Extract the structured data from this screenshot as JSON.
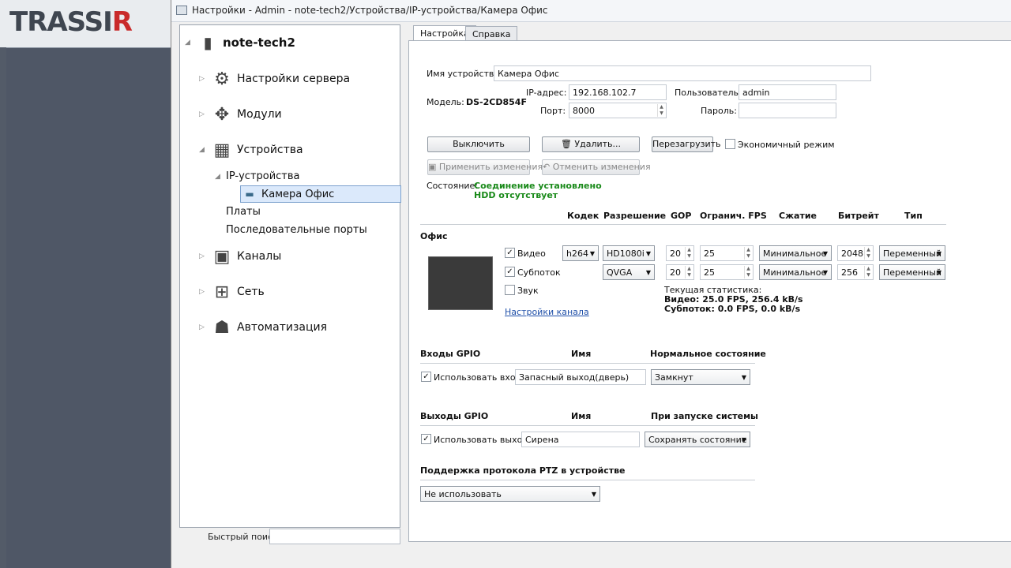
{
  "logo": {
    "text_main": "TRASSI",
    "text_accent": "R"
  },
  "window": {
    "title": "Настройки - Admin - note-tech2/Устройства/IP-устройства/Камера Офис"
  },
  "tree": {
    "root": "note-tech2",
    "items": [
      {
        "label": "Настройки сервера",
        "icon": "gear-icon"
      },
      {
        "label": "Модули",
        "icon": "puzzle-icon"
      },
      {
        "label": "Устройства",
        "icon": "chip-icon"
      },
      {
        "label": "IP-устройства"
      },
      {
        "label": "Камера Офис",
        "icon": "camera-icon"
      },
      {
        "label": "Платы"
      },
      {
        "label": "Последовательные порты"
      },
      {
        "label": "Каналы",
        "icon": "channels-icon"
      },
      {
        "label": "Сеть",
        "icon": "network-icon"
      },
      {
        "label": "Автоматизация",
        "icon": "robot-icon"
      }
    ],
    "quick_search_label": "Быстрый поиск:",
    "quick_search_value": ""
  },
  "tabs": [
    "Настройка",
    "Справка"
  ],
  "device": {
    "name_label": "Имя устройства:",
    "name_value": "Камера Офис",
    "model_label": "Модель:",
    "model_value": "DS-2CD854F",
    "ip_label": "IP-адрес:",
    "ip_value": "192.168.102.7",
    "port_label": "Порт:",
    "port_value": "8000",
    "user_label": "Пользователь:",
    "user_value": "admin",
    "password_label": "Пароль:",
    "password_value": ""
  },
  "buttons": {
    "disable": "Выключить",
    "delete": "Удалить...",
    "reboot": "Перезагрузить",
    "eco_mode": "Экономичный режим",
    "apply": "Применить изменения",
    "cancel": "Отменить изменения"
  },
  "status": {
    "label": "Состояние:",
    "line1": "Соединение установлено",
    "line2": "HDD отсутствует"
  },
  "streams": {
    "headers": {
      "codec": "Кодек",
      "resolution": "Разрешение",
      "gop": "GOP",
      "fps": "Огранич. FPS",
      "compression": "Сжатие",
      "bitrate": "Битрейт",
      "type": "Тип"
    },
    "group": "Офис",
    "video": {
      "label": "Видео",
      "checked": true,
      "codec": "h264",
      "resolution": "HD1080i",
      "gop": "20",
      "fps": "25",
      "compression": "Минимальное",
      "bitrate": "2048",
      "type": "Переменный"
    },
    "substream": {
      "label": "Субпоток",
      "checked": true,
      "resolution": "QVGA",
      "gop": "20",
      "fps": "25",
      "compression": "Минимальное",
      "bitrate": "256",
      "type": "Переменный"
    },
    "audio": {
      "label": "Звук",
      "checked": false
    },
    "channel_settings_link": "Настройки канала",
    "stats_title": "Текущая статистика:",
    "stats_video": "Видео: 25.0 FPS, 256.4 kB/s",
    "stats_sub": "Субпоток: 0.0 FPS, 0.0 kB/s"
  },
  "gpio_in": {
    "title": "Входы GPIO",
    "name_header": "Имя",
    "state_header": "Нормальное состояние",
    "use_label": "Использовать вход",
    "name_value": "Запасный выход(дверь)",
    "state_value": "Замкнут"
  },
  "gpio_out": {
    "title": "Выходы GPIO",
    "name_header": "Имя",
    "state_header": "При запуске системы",
    "use_label": "Использовать выход",
    "name_value": "Сирена",
    "state_value": "Сохранять состояние"
  },
  "ptz": {
    "title": "Поддержка протокола PTZ в устройстве",
    "value": "Не использовать"
  }
}
